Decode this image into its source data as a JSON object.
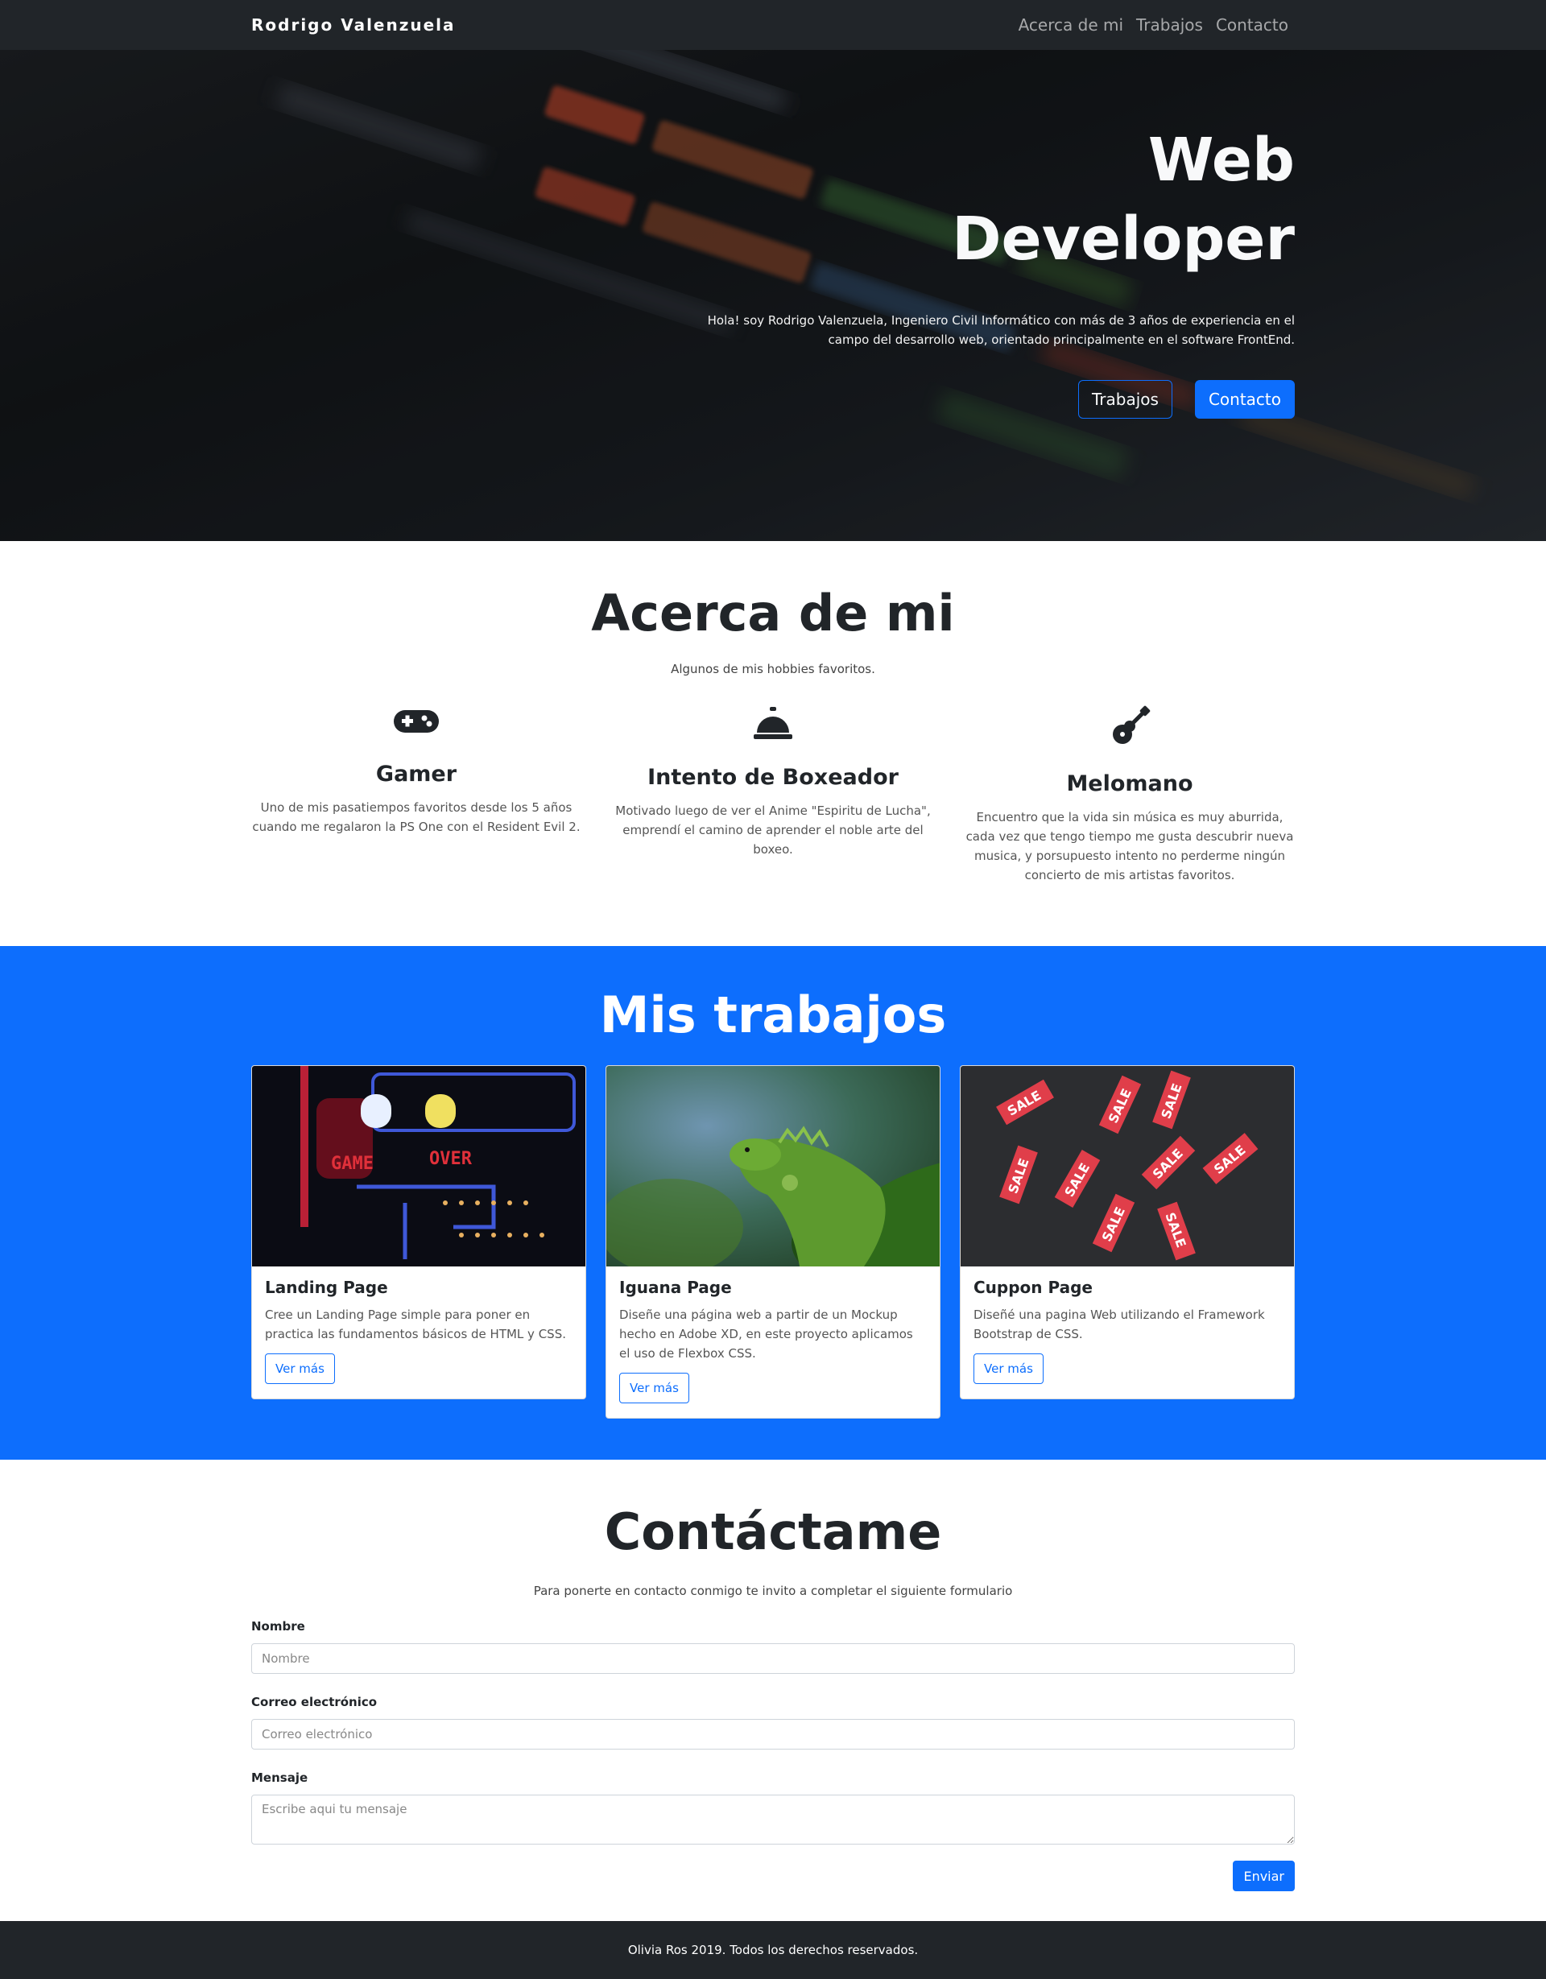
{
  "navbar": {
    "brand": "Rodrigo Valenzuela",
    "links": [
      "Acerca de mi",
      "Trabajos",
      "Contacto"
    ]
  },
  "hero": {
    "title_line1": "Web",
    "title_line2": "Developer",
    "text": "Hola! soy Rodrigo Valenzuela, Ingeniero Civil Informático con más de 3 años de experiencia en el campo del desarrollo web, orientado principalmente en el software FrontEnd.",
    "btn_trabajos": "Trabajos",
    "btn_contacto": "Contacto"
  },
  "about": {
    "title": "Acerca de mi",
    "subtitle": "Algunos de mis hobbies favoritos.",
    "features": [
      {
        "icon": "gamepad-icon",
        "title": "Gamer",
        "text": "Uno de mis pasatiempos favoritos desde los 5 años cuando me regalaron la PS One con el Resident Evil 2."
      },
      {
        "icon": "bell-icon",
        "title": "Intento de Boxeador",
        "text": "Motivado luego de ver el Anime \"Espiritu de Lucha\", emprendí el camino de aprender el noble arte del boxeo."
      },
      {
        "icon": "guitar-icon",
        "title": "Melomano",
        "text": "Encuentro que la vida sin música es muy aburrida, cada vez que tengo tiempo me gusta descubrir nueva musica, y porsupuesto intento no perderme ningún concierto de mis artistas favoritos."
      }
    ]
  },
  "projects": {
    "title": "Mis trabajos",
    "cards": [
      {
        "title": "Landing Page",
        "text": "Cree un Landing Page simple para poner en practica las fundamentos básicos de HTML y CSS.",
        "button": "Ver más",
        "image_text_1": "GAME",
        "image_text_2": "OVER"
      },
      {
        "title": "Iguana Page",
        "text": "Diseñe una página web a partir de un Mockup hecho en Adobe XD, en este proyecto aplicamos el uso de Flexbox CSS.",
        "button": "Ver más"
      },
      {
        "title": "Cuppon Page",
        "text": "Diseñé una pagina Web utilizando el Framework Bootstrap de CSS.",
        "button": "Ver más",
        "image_tag": "SALE"
      }
    ]
  },
  "contact": {
    "title": "Contáctame",
    "subtitle": "Para ponerte en contacto conmigo te invito a completar el siguiente formulario",
    "name_label": "Nombre",
    "name_placeholder": "Nombre",
    "email_label": "Correo electrónico",
    "email_placeholder": "Correo electrónico",
    "message_label": "Mensaje",
    "message_placeholder": "Escribe aqui tu mensaje",
    "submit": "Enviar"
  },
  "footer": {
    "text": "Olivia Ros 2019. Todos los derechos reservados."
  },
  "colors": {
    "primary": "#0d6efd",
    "dark": "#212529"
  }
}
